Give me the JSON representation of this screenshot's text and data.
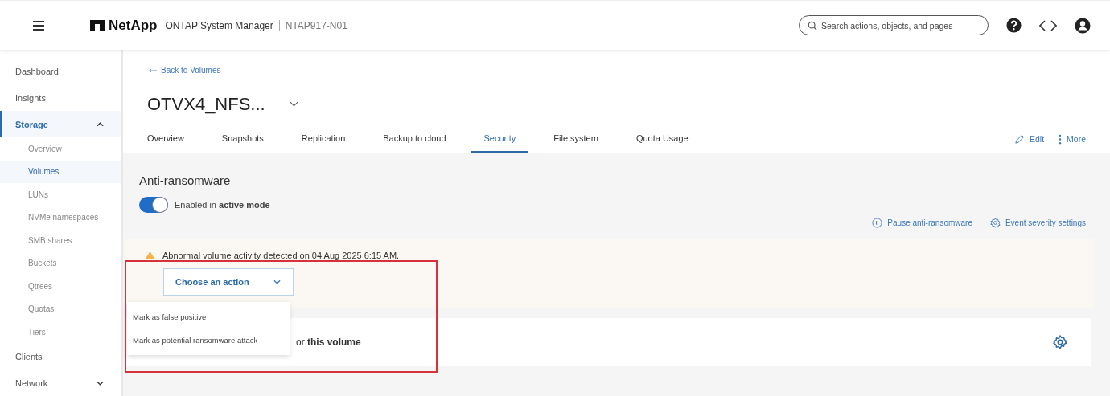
{
  "header": {
    "brand": "NetApp",
    "product": "ONTAP System Manager",
    "cluster": "NTAP917-N01",
    "search": {
      "placeholder": "Search actions, objects, and pages"
    }
  },
  "sidebar": {
    "items": [
      {
        "label": "Dashboard",
        "selected": false
      },
      {
        "label": "Insights",
        "selected": false
      },
      {
        "label": "Storage",
        "selected": true,
        "expanded": true,
        "children": [
          {
            "label": "Overview",
            "selected": false
          },
          {
            "label": "Volumes",
            "selected": true
          },
          {
            "label": "LUNs",
            "selected": false
          },
          {
            "label": "NVMe namespaces",
            "selected": false
          },
          {
            "label": "SMB shares",
            "selected": false
          },
          {
            "label": "Buckets",
            "selected": false
          },
          {
            "label": "Qtrees",
            "selected": false
          },
          {
            "label": "Quotas",
            "selected": false
          },
          {
            "label": "Tiers",
            "selected": false
          }
        ]
      },
      {
        "label": "Clients",
        "selected": false
      },
      {
        "label": "Network",
        "selected": false,
        "expanded": false
      }
    ]
  },
  "back_link": "Back to Volumes",
  "volume_title": "OTVX4_NFS...",
  "tabs": [
    {
      "label": "Overview",
      "selected": false
    },
    {
      "label": "Snapshots",
      "selected": false
    },
    {
      "label": "Replication",
      "selected": false
    },
    {
      "label": "Backup to cloud",
      "selected": false
    },
    {
      "label": "Security",
      "selected": true
    },
    {
      "label": "File system",
      "selected": false
    },
    {
      "label": "Quota Usage",
      "selected": false
    }
  ],
  "actions": [
    "Edit",
    "More"
  ],
  "anti_ransomware": {
    "heading": "Anti-ransomware",
    "toggle": {
      "on": true,
      "label": "Enabled in **active mode**"
    },
    "links": [
      {
        "kind": "pause",
        "label": "Pause anti-ransomware"
      },
      {
        "kind": "settings",
        "label": "Event severity settings"
      }
    ],
    "alert": {
      "message": "Abnormal volume activity detected on 04 Aug 2025 6:15 AM.",
      "button": "Choose an action",
      "menu": [
        "Mark as false positive",
        "Mark as potential ransomware attack"
      ]
    },
    "card_title": "or **this volume**"
  },
  "annotation_frame": true
}
